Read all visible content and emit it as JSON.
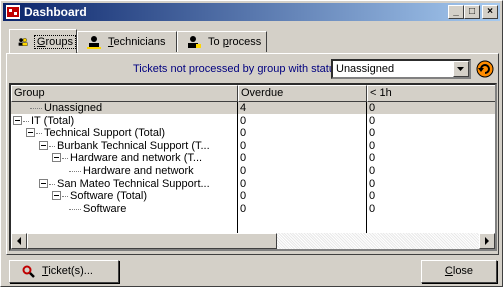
{
  "window": {
    "title": "Dashboard",
    "minimize": "_",
    "maximize": "□",
    "close": "×"
  },
  "tabs": [
    {
      "label_u": "G",
      "label_rest": "roups",
      "icon": "group-icon",
      "active": true
    },
    {
      "label_u": "T",
      "label_rest": "echnicians",
      "icon": "technician-icon",
      "active": false
    },
    {
      "label_pre": "To ",
      "label_u": "p",
      "label_rest": "rocess",
      "icon": "to-process-icon",
      "active": false
    }
  ],
  "filter": {
    "label": "Tickets not processed by group with status:",
    "status_value": "Unassigned"
  },
  "grid": {
    "columns": [
      "Group",
      "Overdue",
      "< 1h"
    ],
    "rows": [
      {
        "group": "Unassigned",
        "overdue": "4",
        "lt1h": "0",
        "level": 1,
        "expander": false,
        "selected": true
      },
      {
        "group": "IT (Total)",
        "overdue": "0",
        "lt1h": "0",
        "level": 0,
        "expander": true,
        "selected": false
      },
      {
        "group": "Technical Support (Total)",
        "overdue": "0",
        "lt1h": "0",
        "level": 1,
        "expander": true,
        "selected": false
      },
      {
        "group": "Burbank Technical Support (T...",
        "overdue": "0",
        "lt1h": "0",
        "level": 2,
        "expander": true,
        "selected": false
      },
      {
        "group": "Hardware and network (T...",
        "overdue": "0",
        "lt1h": "0",
        "level": 3,
        "expander": true,
        "selected": false
      },
      {
        "group": "Hardware and network",
        "overdue": "0",
        "lt1h": "0",
        "level": 4,
        "expander": false,
        "selected": false
      },
      {
        "group": "San Mateo Technical Support...",
        "overdue": "0",
        "lt1h": "0",
        "level": 2,
        "expander": true,
        "selected": false
      },
      {
        "group": "Software (Total)",
        "overdue": "0",
        "lt1h": "0",
        "level": 3,
        "expander": true,
        "selected": false
      },
      {
        "group": "Software",
        "overdue": "0",
        "lt1h": "0",
        "level": 4,
        "expander": false,
        "selected": false
      }
    ]
  },
  "buttons": {
    "tickets_u": "T",
    "tickets_rest": "icket(s)...",
    "close_u": "C",
    "close_rest": "lose"
  },
  "colors": {
    "title_start": "#0a246a",
    "title_end": "#a6caf0",
    "filter_label": "#00007f",
    "face": "#d4d0c8"
  }
}
